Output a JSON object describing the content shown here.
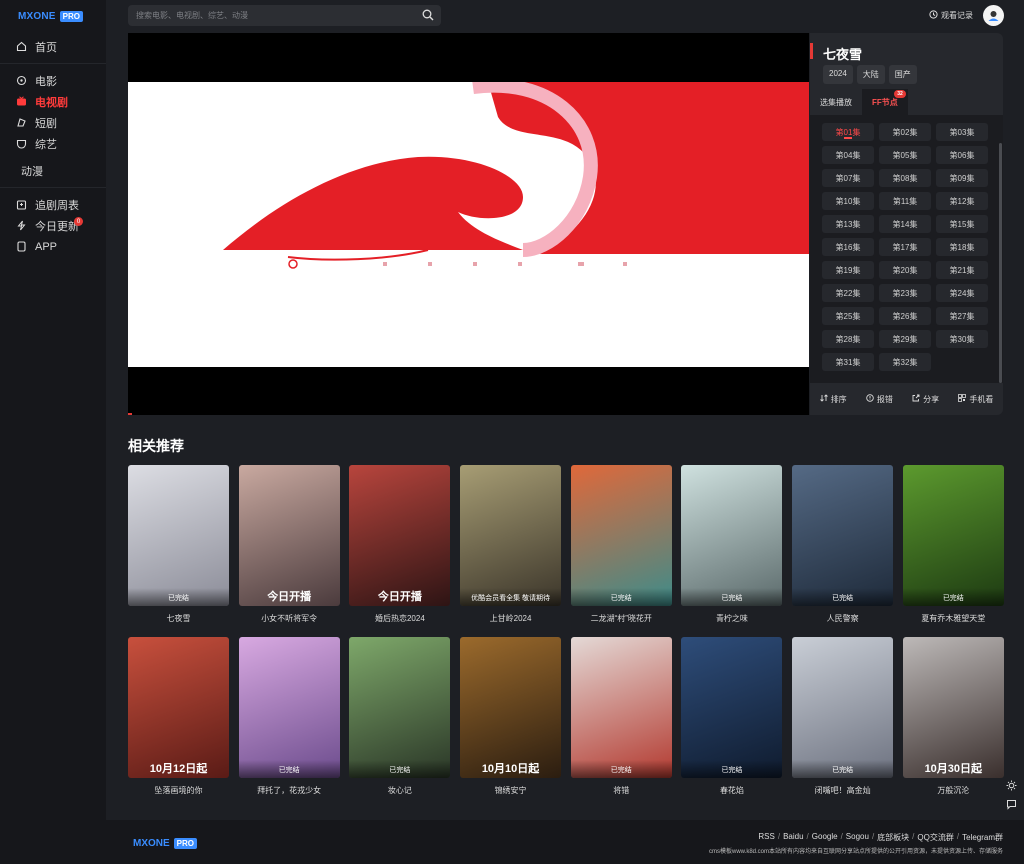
{
  "brand": {
    "mx": "MXONE",
    "pro": "PRO"
  },
  "sidebar": {
    "items": [
      {
        "label": "首页",
        "icon": "home-icon"
      },
      {
        "label": "电影",
        "icon": "movie-icon"
      },
      {
        "label": "电视剧",
        "icon": "tv-icon"
      },
      {
        "label": "短剧",
        "icon": "short-drama-icon"
      },
      {
        "label": "综艺",
        "icon": "variety-icon"
      },
      {
        "label": "动漫"
      },
      {
        "label": "追剧周表",
        "icon": "calendar-icon"
      },
      {
        "label": "今日更新",
        "icon": "bolt-icon",
        "badge": "0"
      },
      {
        "label": "APP",
        "icon": "app-icon"
      }
    ]
  },
  "search": {
    "placeholder": "搜索电影、电视剧、综艺、动漫"
  },
  "header": {
    "history_label": "观看记录"
  },
  "video": {
    "title": "七夜雪",
    "tags": [
      "2024",
      "大陆",
      "国产"
    ],
    "tabs": [
      {
        "label": "选集播放"
      },
      {
        "label": "FF节点",
        "badge": "32"
      }
    ],
    "episodes": [
      "第01集",
      "第02集",
      "第03集",
      "第04集",
      "第05集",
      "第06集",
      "第07集",
      "第08集",
      "第09集",
      "第10集",
      "第11集",
      "第12集",
      "第13集",
      "第14集",
      "第15集",
      "第16集",
      "第17集",
      "第18集",
      "第19集",
      "第20集",
      "第21集",
      "第22集",
      "第23集",
      "第24集",
      "第25集",
      "第26集",
      "第27集",
      "第28集",
      "第29集",
      "第30集",
      "第31集",
      "第32集"
    ],
    "actions": {
      "sort": "排序",
      "report": "报错",
      "share": "分享",
      "mobile": "手机看"
    }
  },
  "related": {
    "title": "相关推荐",
    "items": [
      {
        "name": "七夜雪",
        "status": "已完结",
        "bg": [
          "#dcdde3",
          "#8b8c98"
        ]
      },
      {
        "name": "小女不听将军令",
        "status": "今日开播",
        "bg": [
          "#c9a9a0",
          "#4b3b3d"
        ]
      },
      {
        "name": "婚后热恋2024",
        "status": "今日开播",
        "bg": [
          "#b8453d",
          "#2d1414"
        ]
      },
      {
        "name": "上甘岭2024",
        "status": "优酷会员看全集 敬请期待",
        "bg": [
          "#a79d74",
          "#3b352a"
        ]
      },
      {
        "name": "二龙湖“村”晓花开",
        "status": "已完结",
        "bg": [
          "#e0683a",
          "#3d8c8a"
        ]
      },
      {
        "name": "青柠之味",
        "status": "已完结",
        "bg": [
          "#cfe1df",
          "#5b6a6b"
        ]
      },
      {
        "name": "人民警察",
        "status": "已完结",
        "bg": [
          "#556a85",
          "#1e2a3a"
        ]
      },
      {
        "name": "夏有乔木雅望天堂",
        "status": "已完结",
        "bg": [
          "#5c9a2e",
          "#1d3a12"
        ]
      },
      {
        "name": "坠落画境的你",
        "status": "10月12日起",
        "bg": [
          "#c8503d",
          "#5a1b16"
        ]
      },
      {
        "name": "拜托了，花戎少女",
        "status": "已完结",
        "bg": [
          "#d8a9e1",
          "#6c4c8d"
        ]
      },
      {
        "name": "妆心记",
        "status": "已完结",
        "bg": [
          "#7ea86a",
          "#2a3627"
        ]
      },
      {
        "name": "锦绣安宁",
        "status": "10月10日起",
        "bg": [
          "#9b6a2c",
          "#2b1d10"
        ]
      },
      {
        "name": "将错",
        "status": "已完结",
        "bg": [
          "#e4d9d6",
          "#b33a30"
        ]
      },
      {
        "name": "春花焰",
        "status": "已完结",
        "bg": [
          "#2e4d7a",
          "#0f1b2e"
        ]
      },
      {
        "name": "闭嘴吧！高金灿",
        "status": "已完结",
        "bg": [
          "#c9ced6",
          "#6d7280"
        ]
      },
      {
        "name": "万般沉沦",
        "status": "10月30日起",
        "bg": [
          "#bdb9b8",
          "#3a2f2d"
        ]
      }
    ]
  },
  "footer": {
    "links": [
      "RSS",
      "Baidu",
      "Google",
      "Sogou",
      "底部板块",
      "QQ交流群",
      "Telegram群"
    ],
    "copyright": "cms模板www.k8d.com本站所有内容均来自互联网分享站点所提供的公开引用资源，未提供资源上传、存储服务"
  },
  "colors": {
    "accent": "#e53935",
    "brand": "#3a8dff",
    "bg": "#1d1f24",
    "sidebar": "#16171b"
  }
}
